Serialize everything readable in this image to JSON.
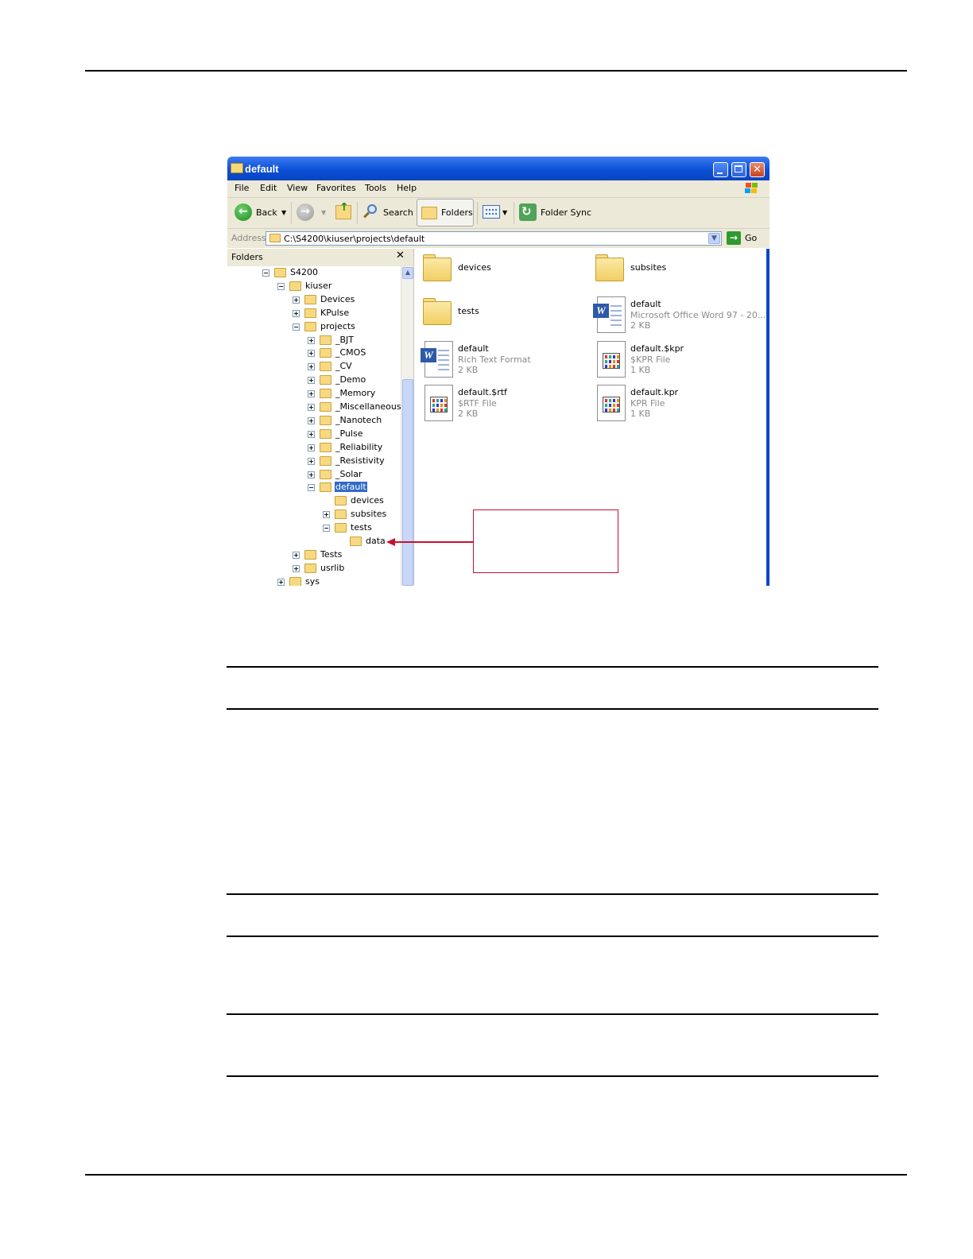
{
  "window": {
    "title": "default",
    "menu": [
      "File",
      "Edit",
      "View",
      "Favorites",
      "Tools",
      "Help"
    ],
    "toolbar": {
      "back": "Back",
      "search": "Search",
      "folders": "Folders",
      "folder_sync": "Folder Sync"
    },
    "address": {
      "label": "Address",
      "value": "C:\\S4200\\kiuser\\projects\\default",
      "go": "Go"
    }
  },
  "folders_pane": {
    "title": "Folders",
    "close": "✕",
    "tree": [
      {
        "label": "S4200",
        "expander": "−"
      },
      {
        "label": "kiuser",
        "expander": "−"
      },
      {
        "label": "Devices",
        "expander": "+"
      },
      {
        "label": "KPulse",
        "expander": "+"
      },
      {
        "label": "projects",
        "expander": "−"
      },
      {
        "label": "_BJT",
        "expander": "+"
      },
      {
        "label": "_CMOS",
        "expander": "+"
      },
      {
        "label": "_CV",
        "expander": "+"
      },
      {
        "label": "_Demo",
        "expander": "+"
      },
      {
        "label": "_Memory",
        "expander": "+"
      },
      {
        "label": "_Miscellaneous",
        "expander": "+"
      },
      {
        "label": "_Nanotech",
        "expander": "+"
      },
      {
        "label": "_Pulse",
        "expander": "+"
      },
      {
        "label": "_Reliability",
        "expander": "+"
      },
      {
        "label": "_Resistivity",
        "expander": "+"
      },
      {
        "label": "_Solar",
        "expander": "+"
      },
      {
        "label": "default",
        "expander": "−",
        "selected": true
      },
      {
        "label": "devices",
        "expander": ""
      },
      {
        "label": "subsites",
        "expander": "+"
      },
      {
        "label": "tests",
        "expander": "−"
      },
      {
        "label": "data",
        "expander": ""
      },
      {
        "label": "Tests",
        "expander": "+"
      },
      {
        "label": "usrlib",
        "expander": "+"
      },
      {
        "label": "sys",
        "expander": "+"
      }
    ]
  },
  "files": [
    {
      "name": "devices",
      "type": "",
      "size": "",
      "icon": "folder-icon"
    },
    {
      "name": "subsites",
      "type": "",
      "size": "",
      "icon": "folder-icon"
    },
    {
      "name": "tests",
      "type": "",
      "size": "",
      "icon": "folder-icon"
    },
    {
      "name": "default",
      "type": "Microsoft Office Word 97 - 20...",
      "size": "2 KB",
      "icon": "word-document-icon"
    },
    {
      "name": "default",
      "type": "Rich Text Format",
      "size": "2 KB",
      "icon": "word-document-icon"
    },
    {
      "name": "default.$kpr",
      "type": "$KPR File",
      "size": "1 KB",
      "icon": "kpr-file-icon"
    },
    {
      "name": "default.$rtf",
      "type": "$RTF File",
      "size": "2 KB",
      "icon": "kpr-file-icon"
    },
    {
      "name": "default.kpr",
      "type": "KPR File",
      "size": "1 KB",
      "icon": "kpr-file-icon"
    }
  ],
  "colors": {
    "titlebar": "#0b4fd6",
    "callout": "#c8102e",
    "selection": "#316ac5"
  }
}
